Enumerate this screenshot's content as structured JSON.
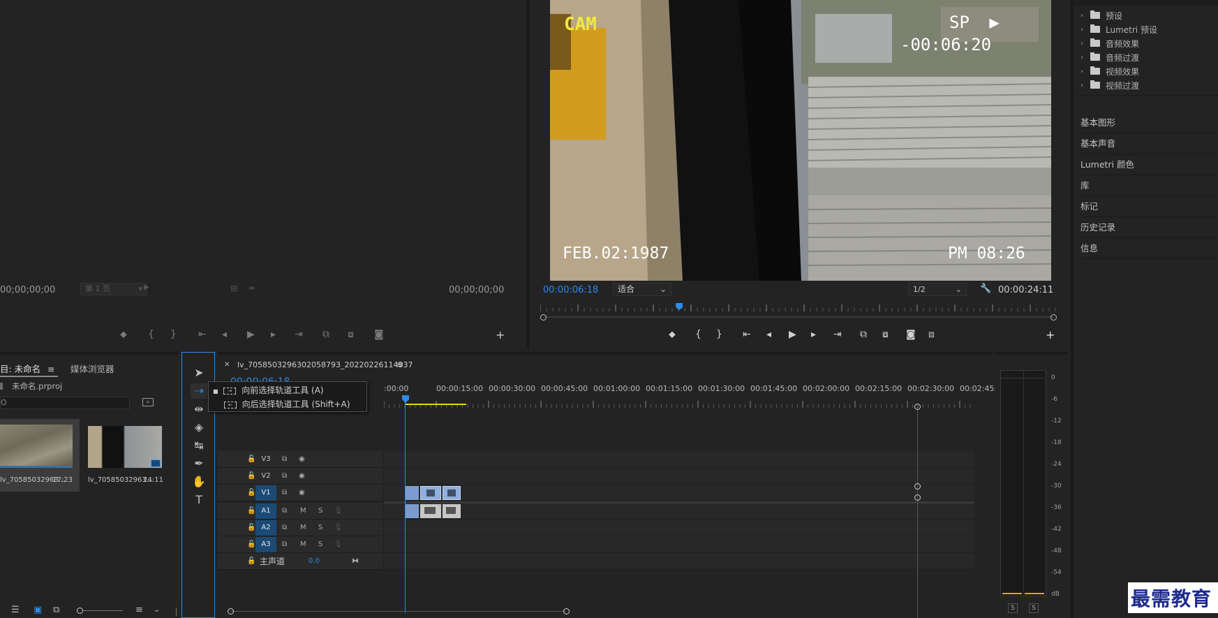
{
  "source_monitor": {
    "timecode_left": "00;00;00;00",
    "page_select": "第 1 页",
    "timecode_right": "00;00;00;00"
  },
  "program_monitor": {
    "video_overlay": {
      "cam": "CAM",
      "sp": "SP",
      "counter": "-00:06:20",
      "date": "FEB.02:1987",
      "time": "PM 08:26"
    },
    "current_time": "00:00:06:18",
    "fit_select": "适合",
    "resolution_select": "1/2",
    "duration": "00:00:24:11",
    "playhead_fraction": 0.266
  },
  "effects": {
    "folders": [
      {
        "label": "预设"
      },
      {
        "label": "Lumetri 预设"
      },
      {
        "label": "音频效果"
      },
      {
        "label": "音频过渡"
      },
      {
        "label": "视频效果"
      },
      {
        "label": "视频过渡"
      }
    ],
    "panels": [
      {
        "label": "基本图形"
      },
      {
        "label": "基本声音"
      },
      {
        "label": "Lumetri 颜色"
      },
      {
        "label": "库"
      },
      {
        "label": "标记"
      },
      {
        "label": "历史记录"
      },
      {
        "label": "信息"
      }
    ]
  },
  "project": {
    "tab_project": "目: 未命名",
    "tab_media": "媒体浏览器",
    "file_name": "未命名.prproj",
    "clips": [
      {
        "name": "lv_70585032963...",
        "duration": "17:23"
      },
      {
        "name": "lv_70585032963...",
        "duration": "24:11"
      }
    ]
  },
  "timeline": {
    "sequence_name": "lv_7058503296302058793_20220226114937",
    "timecode": "00:00:06:18",
    "ruler": [
      ":00:00",
      "00:00:15:00",
      "00:00:30:00",
      "00:00:45:00",
      "00:01:00:00",
      "00:01:15:00",
      "00:01:30:00",
      "00:01:45:00",
      "00:02:00:00",
      "00:02:15:00",
      "00:02:30:00",
      "00:02:45:"
    ],
    "video_tracks": [
      "V3",
      "V2",
      "V1"
    ],
    "audio_tracks": [
      "A1",
      "A2",
      "A3"
    ],
    "master_label": "主声道",
    "master_value": "0.0",
    "mute_label": "M",
    "solo_label": "S"
  },
  "tooltip": {
    "forward": "向前选择轨道工具 (A)",
    "backward": "向后选择轨道工具 (Shift+A)"
  },
  "meter": {
    "scale": [
      "0",
      "-6",
      "-12",
      "-18",
      "-24",
      "-30",
      "-36",
      "-42",
      "-48",
      "-54",
      "dB"
    ],
    "solo_left": "S",
    "solo_right": "S"
  },
  "watermark": "最需教育",
  "colors": {
    "accent_blue": "#2d8ceb",
    "track_badge_blue": "#1b4a75",
    "playhead_blue": "#2d8ceb",
    "work_area_yellow": "#e6d800"
  }
}
